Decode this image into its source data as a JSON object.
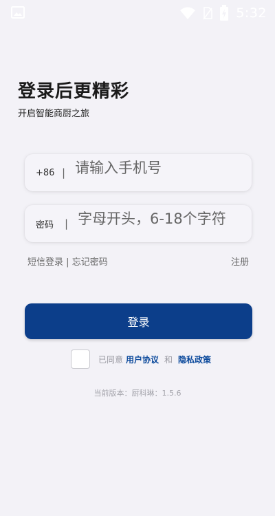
{
  "status_bar": {
    "time": "5:32",
    "icons": [
      "image-icon",
      "wifi-icon",
      "no-sim-icon",
      "battery-charging-icon"
    ]
  },
  "header": {
    "title": "登录后更精彩",
    "subtitle": "开启智能商厨之旅"
  },
  "phone_field": {
    "prefix": "+86",
    "separator": "|",
    "placeholder": "请输入手机号"
  },
  "password_field": {
    "prefix": "密码",
    "separator": "|",
    "placeholder": "字母开头，6-18个字符"
  },
  "links": {
    "sms_login": "短信登录",
    "divider": "|",
    "forgot_password": "忘记密码",
    "register": "注册"
  },
  "login_button": {
    "label": "登录"
  },
  "agreement": {
    "agreed_text": "已同意",
    "user_agreement": "用户协议",
    "and_text": "和",
    "privacy_policy": "隐私政策",
    "checked": false
  },
  "version": {
    "text": "当前版本：厨科琳：1.5.6"
  },
  "colors": {
    "background": "#f3f2f7",
    "primary": "#0c3e8a",
    "link": "#0c4a9c"
  }
}
